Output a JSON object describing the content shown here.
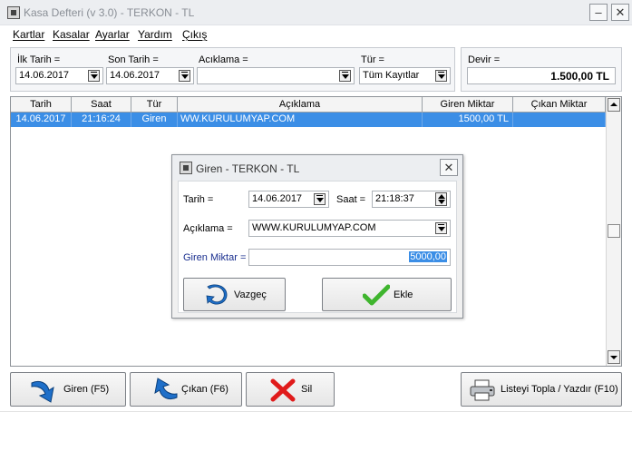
{
  "window": {
    "title": "Kasa Defteri (v 3.0) - TERKON - TL",
    "min_label": "–",
    "close_label": "✕"
  },
  "menu": {
    "items": [
      "Kartlar",
      "Kasalar",
      "Ayarlar",
      "Yardım",
      "Çıkış"
    ]
  },
  "filters": {
    "ilk_tarih_label": "İlk Tarih =",
    "ilk_tarih_value": "14.06.2017",
    "son_tarih_label": "Son Tarih =",
    "son_tarih_value": "14.06.2017",
    "aciklama_label": "Acıklama =",
    "aciklama_value": "",
    "tur_label": "Tür =",
    "tur_value": "Tüm Kayıtlar",
    "devir_label": "Devir =",
    "devir_value": "1.500,00 TL"
  },
  "table": {
    "columns": [
      "Tarih",
      "Saat",
      "Tür",
      "Açıklama",
      "Giren Miktar",
      "Çıkan Miktar"
    ],
    "rows": [
      {
        "tarih": "14.06.2017",
        "saat": "21:16:24",
        "tur": "Giren",
        "aciklama": "WW.KURULUMYAP.COM",
        "giren": "1500,00 TL",
        "cikan": ""
      }
    ]
  },
  "buttons": {
    "giren": "Giren (F5)",
    "cikan": "Çıkan (F6)",
    "sil": "Sil",
    "listeyi": "Listeyi Topla / Yazdır (F10)"
  },
  "dialog": {
    "title": "Giren - TERKON - TL",
    "close_label": "✕",
    "tarih_label": "Tarih =",
    "tarih_value": "14.06.2017",
    "saat_label": "Saat =",
    "saat_value": "21:18:37",
    "aciklama_label": "Açıklama =",
    "aciklama_value": "WWW.KURULUMYAP.COM",
    "miktar_label": "Giren Miktar =",
    "miktar_value": "5000,00",
    "vazgec_label": "Vazgeç",
    "ekle_label": "Ekle"
  },
  "colors": {
    "selection": "#3b8ee6",
    "miktar_label": "#1a2f8f",
    "giren_arrow": "#1e6fc9",
    "sil_icon": "#e01b1b",
    "ekle_check": "#3fb52e"
  },
  "icons": [
    "app-icon",
    "dropdown-icon",
    "spin-icon",
    "giren-arrow-icon",
    "cikan-arrow-icon",
    "delete-x-icon",
    "printer-icon",
    "undo-arrow-icon",
    "check-icon",
    "close-icon"
  ]
}
